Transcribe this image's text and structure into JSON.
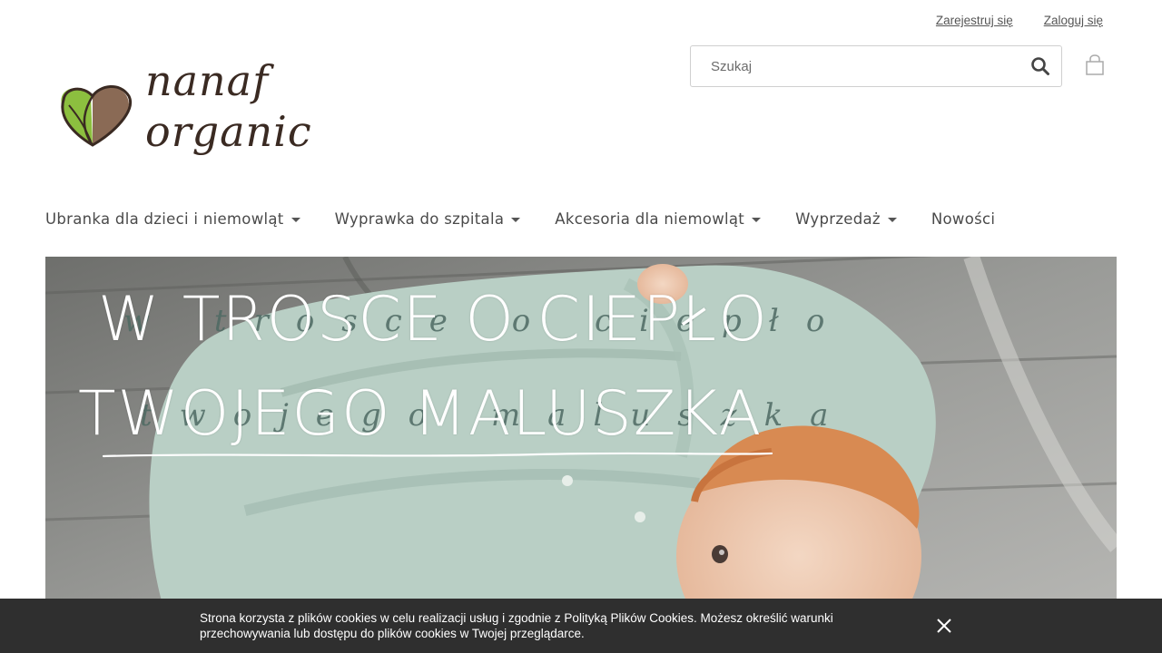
{
  "header": {
    "register_link": "Zarejestruj się",
    "login_link": "Zaloguj się",
    "logo": {
      "line1": "nanaf",
      "line2": "organic"
    },
    "search": {
      "placeholder": "Szukaj",
      "value": ""
    },
    "icons": {
      "search": "search-icon",
      "cart": "shopping-bag-icon"
    }
  },
  "nav": {
    "items": [
      {
        "label": "Ubranka dla dzieci i niemowląt",
        "dropdown": true
      },
      {
        "label": "Wyprawka do szpitala",
        "dropdown": true
      },
      {
        "label": "Akcesoria dla niemowląt",
        "dropdown": true
      },
      {
        "label": "Wyprzedaż",
        "dropdown": true
      },
      {
        "label": "Nowości",
        "dropdown": false
      }
    ]
  },
  "hero": {
    "headline_line1": "W TROSCE O CIEPŁO",
    "headline_line2": "TWOJEGO MALUSZKA",
    "script_line1": "w trosce o ciepło",
    "script_line2": "twojego maluszka"
  },
  "cookie_bar": {
    "text": "Strona korzysta z plików cookies w celu realizacji usług i zgodnie z Polityką Plików Cookies. Możesz określić warunki przechowywania lub dostępu do plików cookies w Twojej przeglądarce.",
    "close_icon": "close-icon"
  },
  "colors": {
    "logo_brown": "#3a2a22",
    "logo_green": "#8cbf3f",
    "logo_heart_brown": "#8a6a55",
    "nav_text": "#4a4a4a",
    "cookie_bg": "#2f2f2f",
    "script_green": "#4e6a63"
  }
}
